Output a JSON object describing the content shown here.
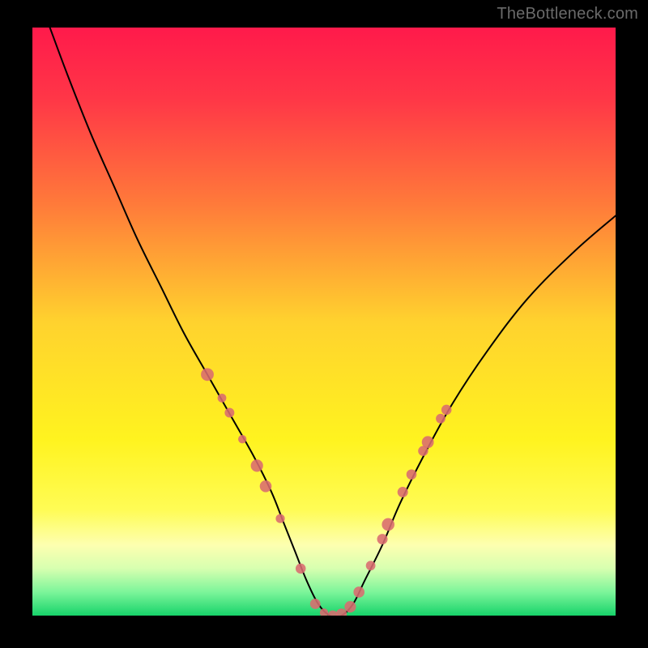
{
  "watermark": "TheBottleneck.com",
  "chart_data": {
    "type": "line",
    "title": "",
    "xlabel": "",
    "ylabel": "",
    "xlim": [
      0,
      100
    ],
    "ylim": [
      0,
      100
    ],
    "grid": false,
    "background": {
      "type": "vertical-gradient",
      "stops": [
        {
          "offset": 0.0,
          "color": "#ff1a4b"
        },
        {
          "offset": 0.12,
          "color": "#ff3647"
        },
        {
          "offset": 0.3,
          "color": "#ff7a3a"
        },
        {
          "offset": 0.5,
          "color": "#ffd22e"
        },
        {
          "offset": 0.7,
          "color": "#fff31f"
        },
        {
          "offset": 0.82,
          "color": "#fffc55"
        },
        {
          "offset": 0.88,
          "color": "#fdffb0"
        },
        {
          "offset": 0.92,
          "color": "#d7ffb0"
        },
        {
          "offset": 0.96,
          "color": "#7cf59a"
        },
        {
          "offset": 1.0,
          "color": "#17d36a"
        }
      ]
    },
    "series": [
      {
        "name": "bottleneck-curve",
        "stroke": "#000000",
        "stroke_width": 2,
        "x": [
          3,
          6,
          10,
          14,
          18,
          22,
          26,
          30,
          34,
          38,
          41,
          43,
          45,
          47,
          49,
          51,
          53,
          55,
          57,
          60,
          63,
          67,
          72,
          78,
          85,
          93,
          100
        ],
        "y": [
          100,
          92,
          82,
          73,
          64,
          56,
          48,
          41,
          34,
          27,
          21,
          16,
          11,
          6,
          2,
          0,
          0,
          2,
          6,
          12,
          19,
          27,
          36,
          45,
          54,
          62,
          68
        ]
      }
    ],
    "markers": {
      "color": "#d96b6f",
      "radius_range": [
        5,
        8
      ],
      "points": [
        {
          "x": 30.0,
          "y": 41.0
        },
        {
          "x": 32.5,
          "y": 37.0
        },
        {
          "x": 33.8,
          "y": 34.5
        },
        {
          "x": 36.0,
          "y": 30.0
        },
        {
          "x": 38.5,
          "y": 25.5
        },
        {
          "x": 40.0,
          "y": 22.0
        },
        {
          "x": 42.5,
          "y": 16.5
        },
        {
          "x": 46.0,
          "y": 8.0
        },
        {
          "x": 48.5,
          "y": 2.0
        },
        {
          "x": 50.0,
          "y": 0.5
        },
        {
          "x": 51.5,
          "y": 0.0
        },
        {
          "x": 53.0,
          "y": 0.3
        },
        {
          "x": 54.5,
          "y": 1.5
        },
        {
          "x": 56.0,
          "y": 4.0
        },
        {
          "x": 58.0,
          "y": 8.5
        },
        {
          "x": 60.0,
          "y": 13.0
        },
        {
          "x": 61.0,
          "y": 15.5
        },
        {
          "x": 63.5,
          "y": 21.0
        },
        {
          "x": 65.0,
          "y": 24.0
        },
        {
          "x": 67.0,
          "y": 28.0
        },
        {
          "x": 67.8,
          "y": 29.5
        },
        {
          "x": 70.0,
          "y": 33.5
        },
        {
          "x": 71.0,
          "y": 35.0
        }
      ]
    }
  }
}
